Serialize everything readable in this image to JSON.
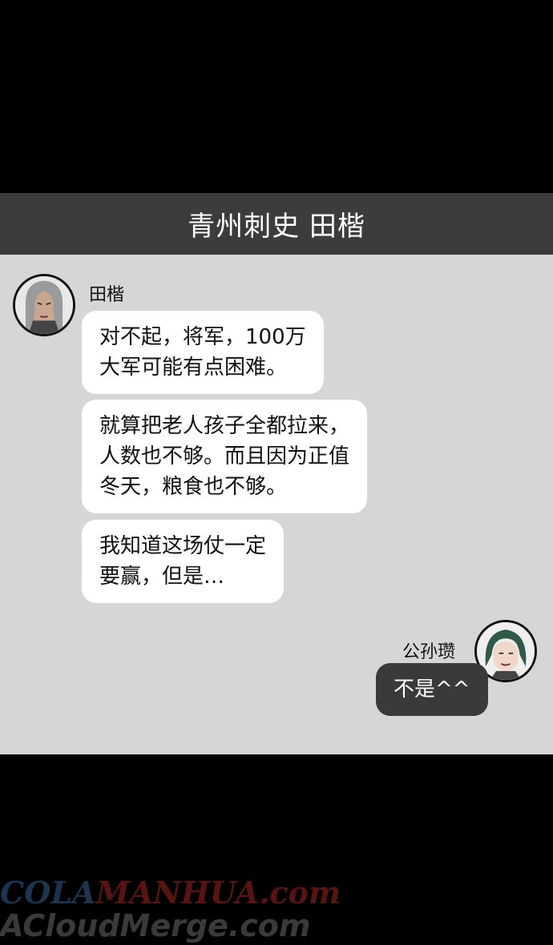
{
  "header": {
    "title": "青州刺史 田楷"
  },
  "messages": [
    {
      "sender": "田楷",
      "avatar": "tian-kai-avatar-icon",
      "bubbles": [
        {
          "lines": [
            "对不起，将军，100万",
            "大军可能有点困难。"
          ]
        },
        {
          "lines": [
            "就算把老人孩子全都拉来，",
            "人数也不够。而且因为正值",
            "冬天，粮食也不够。"
          ]
        },
        {
          "lines": [
            "我知道这场仗一定",
            "要赢，但是…"
          ]
        }
      ]
    },
    {
      "sender": "公孙瓒",
      "avatar": "gongsun-zan-avatar-icon",
      "bubbles": [
        {
          "lines": [
            "不是^^"
          ]
        }
      ]
    }
  ],
  "watermark": {
    "part1": "COLA",
    "part2": "MANHUA.com",
    "line2": "ACloudMerge.com"
  },
  "colors": {
    "header_bg": "#3c3c3c",
    "chat_bg": "#d6d6d6",
    "bubble_light": "#ffffff",
    "bubble_dark": "#3a3a3a"
  }
}
